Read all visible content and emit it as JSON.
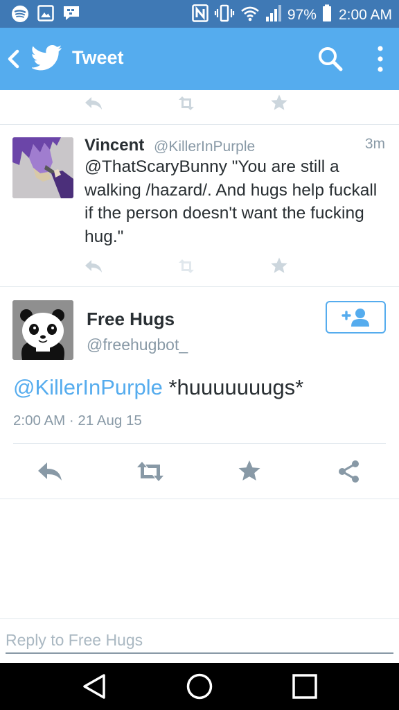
{
  "status_bar": {
    "battery": "97%",
    "time": "2:00 AM"
  },
  "app_bar": {
    "title": "Tweet"
  },
  "reply_tweet": {
    "name": "Vincent",
    "handle": "@KillerInPurple",
    "time_ago": "3m",
    "text": "@ThatScaryBunny \"You are still a walking /hazard/. And hugs help fuckall if the person doesn't want the fucking hug.\""
  },
  "main_tweet": {
    "name": "Free Hugs",
    "handle": "@freehugbot_",
    "mention": "@KillerInPurple",
    "text": " *huuuuuuugs*",
    "timestamp": "2:00 AM · 21 Aug 15"
  },
  "reply_box": {
    "placeholder": "Reply to Free Hugs"
  },
  "colors": {
    "brand": "#55acee",
    "status_bar": "#3f79b5",
    "icon_gray": "#8899a6",
    "text": "#292f33"
  },
  "icons": [
    "spotify-icon",
    "gallery-icon",
    "bbm-icon",
    "nfc-icon",
    "vibrate-icon",
    "wifi-icon",
    "signal-icon",
    "battery-icon",
    "back-arrow-icon",
    "twitter-bird-icon",
    "search-icon",
    "more-vert-icon",
    "reply-icon",
    "retweet-icon",
    "favorite-icon",
    "share-icon",
    "follow-icon",
    "nav-back-icon",
    "nav-home-icon",
    "nav-recents-icon"
  ]
}
